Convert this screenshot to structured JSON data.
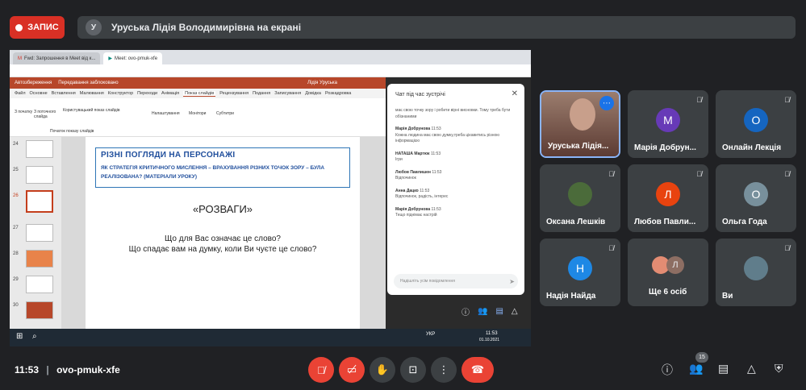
{
  "top": {
    "record_label": "ЗАПИС",
    "presenter_initial": "У",
    "presenter_text": "Уруська Лідія Володимирівна на екрані"
  },
  "shared": {
    "tabs": [
      "Fwd: Запрошення в Meet від к...",
      "Meet: ovo-pmuk-xfe"
    ],
    "ppt_title": "Автозбереження",
    "ppt_file": "Передавання заблоковано",
    "ppt_user": "Лідія Уруська",
    "ribbon_tabs": [
      "Файл",
      "Основне",
      "Вставлення",
      "Малювання",
      "Конструктор",
      "Переходи",
      "Анімація",
      "Показ слайдів",
      "Рецензування",
      "Подання",
      "Записування",
      "Довідка",
      "Розкадровка"
    ],
    "ribbon_selected": "Показ слайдів",
    "ribbon_groups": [
      "З початку",
      "З поточного слайда",
      "Користувацький показ слайдів",
      "Початок показу слайдів",
      "Налаштування",
      "Монітори",
      "Субтитри"
    ],
    "thumb_numbers": [
      "24",
      "25",
      "26",
      "27",
      "28",
      "29",
      "30"
    ],
    "slide": {
      "heading": "РІЗНІ ПОГЛЯДИ НА ПЕРСОНАЖІ",
      "subheading": "ЯК СТРАТЕГІЯ КРИТИЧНОГО МИСЛЕННЯ – ВРАХУВАННЯ РІЗНИХ ТОЧОК ЗОРУ – БУЛА РЕАЛІЗОВАНА? (МАТЕРІАЛИ УРОКУ)",
      "big": "«РОЗВАГИ»",
      "q1": "Що для Вас означає це слово?",
      "q2": "Що спадає вам на думку, коли Ви чуєте це слово?"
    },
    "taskbar_time": "11:53",
    "taskbar_date": "01.10.2021",
    "taskbar_lang": "УКР"
  },
  "chat": {
    "title": "Чат під час зустрічі",
    "messages": [
      {
        "name": "",
        "time": "",
        "text": "має свою точку зору і робити вірні висновки. Тому треба бути обізнаними"
      },
      {
        "name": "Марія Добрунова",
        "time": "11:53",
        "text": "Кожна людина має свою думку,треба цікавитись різною інформацією"
      },
      {
        "name": "НАТАША Мартюк",
        "time": "11:53",
        "text": "Ігри"
      },
      {
        "name": "Любов Павлишен",
        "time": "11:53",
        "text": "Відпочинок"
      },
      {
        "name": "Анна Дацко",
        "time": "11:53",
        "text": "Відпочинок, радість, інтерес"
      },
      {
        "name": "Марія Добрунова",
        "time": "11:53",
        "text": "Тещо піднімає настрій"
      }
    ],
    "input_placeholder": "Надішліть усім повідомлення"
  },
  "tiles": [
    {
      "name": "Уруська Лідія...",
      "initial": "",
      "color": "#7a5a50",
      "mute": false
    },
    {
      "name": "Марія Добрун...",
      "initial": "М",
      "color": "#673ab7",
      "mute": true
    },
    {
      "name": "Онлайн Лекція",
      "initial": "О",
      "color": "#1565c0",
      "mute": true
    },
    {
      "name": "Оксана Лешків",
      "initial": "",
      "color": "#4b6b3a",
      "mute": true
    },
    {
      "name": "Любов Павли...",
      "initial": "Л",
      "color": "#e8430f",
      "mute": true
    },
    {
      "name": "Ольга Года",
      "initial": "О",
      "color": "#78909c",
      "mute": true
    },
    {
      "name": "Надія Найда",
      "initial": "Н",
      "color": "#1e88e5",
      "mute": true
    },
    {
      "name": "Ще 6 осіб",
      "initial": "Л",
      "color": "#8d6e63",
      "mute": false
    },
    {
      "name": "Ви",
      "initial": "",
      "color": "#607d8b",
      "mute": true
    }
  ],
  "bottom": {
    "time": "11:53",
    "separator": "|",
    "meeting_code": "ovo-pmuk-xfe",
    "participants_count": "15"
  }
}
